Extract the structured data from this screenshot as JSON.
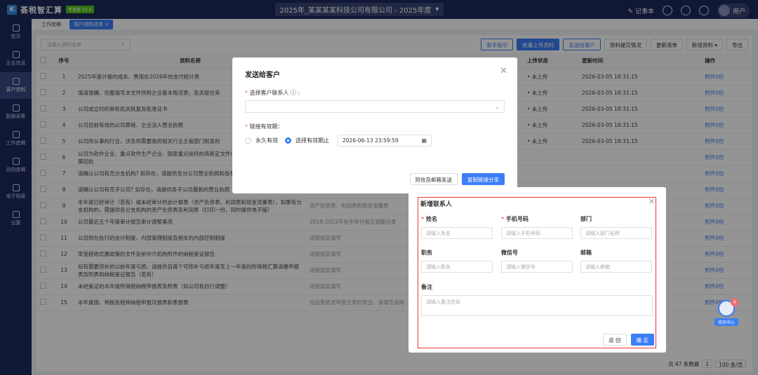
{
  "app": {
    "name": "荟税智汇算",
    "version_badge": "专享版 V2.0",
    "company": "2025年_某某某某科技公司有限公司 - 2025年度",
    "notebook": "记事本",
    "user": "用户"
  },
  "sidebar": [
    {
      "label": "首页"
    },
    {
      "label": "企业信息"
    },
    {
      "label": "客户资料",
      "active": true
    },
    {
      "label": "数据采集"
    },
    {
      "label": "工作底稿"
    },
    {
      "label": "自由底稿"
    },
    {
      "label": "电子档案"
    },
    {
      "label": "设置"
    }
  ],
  "tabs": [
    {
      "label": "工作底稿"
    },
    {
      "label": "客户资料清单 ×"
    }
  ],
  "toolbar": {
    "search_placeholder": "请输入资料名称",
    "buttons": [
      "新手指引",
      "批量上传资料",
      "发送给客户",
      "资料提交情况",
      "更新清单",
      "新增资料",
      "导出"
    ]
  },
  "table": {
    "headers": [
      "序号",
      "资料名称",
      "上传状态",
      "更新时间",
      "操作"
    ],
    "rows": [
      {
        "no": "1",
        "name": "2025年度计提的成本、费用在2026年的支付统计表",
        "status": "• 未上传",
        "time": "2026-03-05 18:31:15",
        "op": "附件0份"
      },
      {
        "no": "2",
        "name": "填请准确、完整填写本文件所附企业基本情况表，及关联往来",
        "status": "• 未上传",
        "time": "2026-03-05 18:31:15",
        "op": "附件0份"
      },
      {
        "no": "3",
        "name": "公司成立时的审批机关批复及批准证书",
        "status": "• 未上传",
        "time": "2026-03-05 18:31:15",
        "op": "附件0份"
      },
      {
        "no": "4",
        "name": "公司目前有效的公司章程、企业法人营业执照",
        "status": "• 未上传",
        "time": "2026-03-05 18:31:15",
        "op": "附件0份"
      },
      {
        "no": "5",
        "name": "公司所从事的行业，涉及到需要政府相关行业主管部门批发的",
        "status": "• 未上传",
        "time": "2026-03-05 18:31:15",
        "op": "附件0份"
      },
      {
        "no": "6",
        "name": "公司为软件企业、重点软件生产企业、国家重点扶持的高新定文件/证书，及企业所得税减免税备案回执",
        "status": "",
        "time": "",
        "op": "附件0份"
      },
      {
        "no": "7",
        "name": "请确认公司有无分支机构? 如存在，请提供各分公司营业执照和各季度企业所得税缴纳信息",
        "status": "",
        "time": "",
        "op": "附件0份"
      },
      {
        "no": "8",
        "name": "请确认公司有无子公司? 如存在，请提供各子公司最新的营业执照",
        "status": "",
        "time": "",
        "op": "附件0份"
      },
      {
        "no": "9",
        "name": "本年度已经审计（若有）或未经审计的会计报表（资产负债表、利润表和现金流量表），如果有分支机构的，需提供各分支机构的资产负债表及利润表（打印一份，同时提供电子版）",
        "status": "",
        "time": "",
        "op": "附件0份"
      },
      {
        "no": "10",
        "name": "公司最近五个年度审计报告审计调整事项",
        "status": "",
        "time": "",
        "op": "附件0份"
      },
      {
        "no": "11",
        "name": "公司现在执行的会计制度、内部管理制度及相关的内部控制制度",
        "status": "",
        "time": "",
        "op": "附件0份"
      },
      {
        "no": "12",
        "name": "享受税收优惠政策的文件及前中介机构所作的纳税鉴证报告",
        "status": "",
        "time": "",
        "op": "附件0份"
      },
      {
        "no": "13",
        "name": "如有需要弥补的以前年度亏损，请提供自首个可弥补亏损年度至上一年度的所得税汇算清缴申报表及附表和纳税鉴证报告（若有）",
        "status": "",
        "time": "",
        "op": "附件0份"
      },
      {
        "no": "14",
        "name": "未经鉴证的本年度所得税纳税申报表及附表（如公司有自行调整）",
        "status": "",
        "time": "",
        "op": "附件0份"
      },
      {
        "no": "15",
        "name": "本年度国、地税各税种纳税申报月报表和季报表",
        "status": "",
        "time": "",
        "op": "附件0份"
      }
    ],
    "extra_col": [
      "",
      "",
      "",
      "",
      "",
      "",
      "请按规定填写",
      "请按规定填写",
      "资产负债表、利润表和现金流量表",
      "2018-2022年各年审计报告调整分录",
      "请按规定填写",
      "请按规定填写",
      "请按规定填写",
      "请按规定填写",
      "包括免抵退申报主表的导出、请填写说明"
    ]
  },
  "footer": {
    "total": "共 47 条数据",
    "page": "1",
    "page_size": "100 条/页"
  },
  "modal_send": {
    "title": "发送给客户",
    "contact_label": "选择客户联系人",
    "validity_label": "链接有效期：",
    "option_forever": "永久有效",
    "option_period": "选择有效期止",
    "date_value": "2026-06-13 23:59:59",
    "btn_sms": "短信及邮箱发送",
    "btn_copy": "复制链接分享"
  },
  "modal_contact": {
    "title": "新增联系人",
    "fields": {
      "name": {
        "label": "姓名",
        "placeholder": "请输入姓名"
      },
      "phone": {
        "label": "手机号码",
        "placeholder": "请输入手机号码"
      },
      "dept": {
        "label": "部门",
        "placeholder": "请输入部门名称"
      },
      "position": {
        "label": "职务",
        "placeholder": "请输入职务"
      },
      "wechat": {
        "label": "微信号",
        "placeholder": "请输入微信号"
      },
      "email": {
        "label": "邮箱",
        "placeholder": "请输入邮箱"
      },
      "remark": {
        "label": "备注",
        "placeholder": "请输入备注信息"
      }
    },
    "btn_back": "返 回",
    "btn_ok": "确 定"
  },
  "helper": {
    "badge": "4",
    "label": "待办中心"
  }
}
